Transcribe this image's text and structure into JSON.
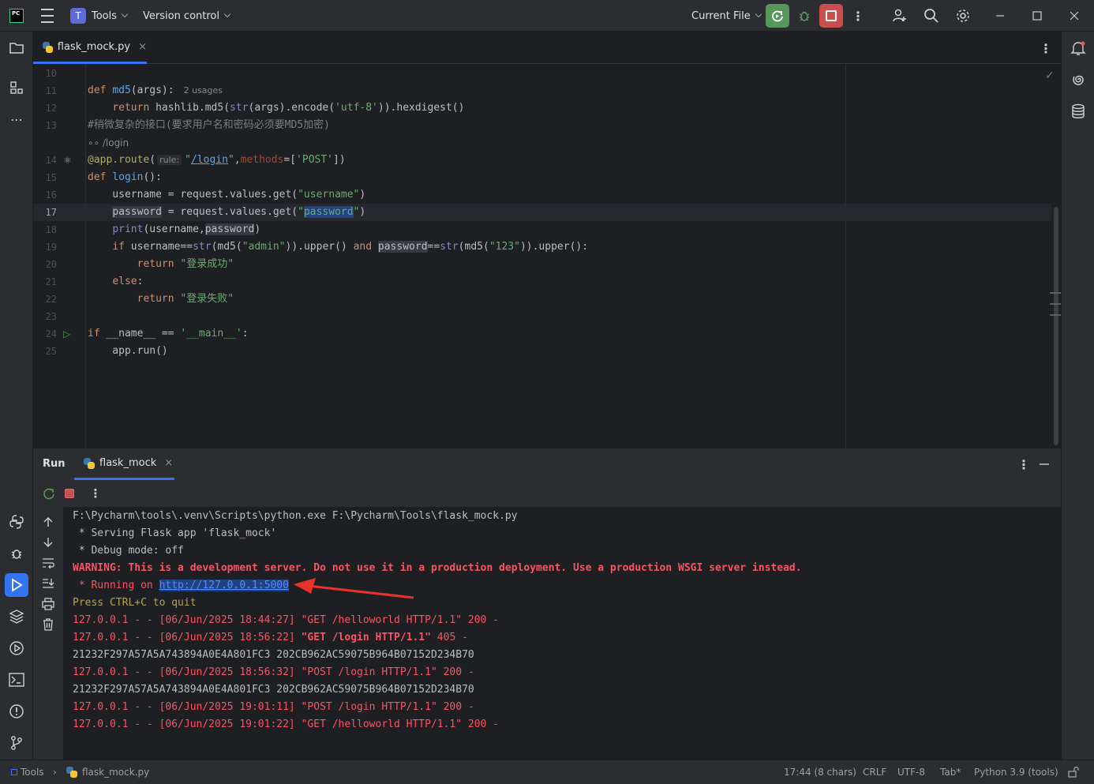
{
  "titlebar": {
    "app_logo": "PC",
    "project_initial": "T",
    "project_name": "Tools",
    "vcs_label": "Version control",
    "run_config": "Current File"
  },
  "editor": {
    "tab_label": "flask_mock.py",
    "lines": [
      {
        "n": "10"
      },
      {
        "n": "11",
        "usages": "2 usages"
      },
      {
        "n": "12"
      },
      {
        "n": "13",
        "comment": "#稍微复杂的接口(要求用户名和密码必须要MD5加密)"
      },
      {
        "route_hint": "/login"
      },
      {
        "n": "14",
        "rule_hint": "rule:"
      },
      {
        "n": "15"
      },
      {
        "n": "16"
      },
      {
        "n": "17"
      },
      {
        "n": "18"
      },
      {
        "n": "19"
      },
      {
        "n": "20",
        "string": "\"登录成功\""
      },
      {
        "n": "21"
      },
      {
        "n": "22",
        "string": "\"登录失败\""
      },
      {
        "n": "23"
      },
      {
        "n": "24"
      },
      {
        "n": "25"
      }
    ]
  },
  "run_panel": {
    "title": "Run",
    "tab_label": "flask_mock",
    "console": [
      "F:\\Pycharm\\tools\\.venv\\Scripts\\python.exe F:\\Pycharm\\Tools\\flask_mock.py",
      " * Serving Flask app 'flask_mock'",
      " * Debug mode: off",
      "WARNING: This is a development server. Do not use it in a production deployment. Use a production WSGI server instead.",
      " * Running on ",
      "http://127.0.0.1:5000",
      "Press CTRL+C to quit",
      "127.0.0.1 - - [06/Jun/2025 18:44:27] \"GET /helloworld HTTP/1.1\" 200 -",
      "127.0.0.1 - - [06/Jun/2025 18:56:22] ",
      "\"GET /login HTTP/1.1\"",
      " 405 -",
      "21232F297A57A5A743894A0E4A801FC3 202CB962AC59075B964B07152D234B70",
      "127.0.0.1 - - [06/Jun/2025 18:56:32] \"POST /login HTTP/1.1\" 200 -",
      "21232F297A57A5A743894A0E4A801FC3 202CB962AC59075B964B07152D234B70",
      "127.0.0.1 - - [06/Jun/2025 19:01:11] \"POST /login HTTP/1.1\" 200 -",
      "127.0.0.1 - - [06/Jun/2025 19:01:22] \"GET /helloworld HTTP/1.1\" 200 -"
    ]
  },
  "statusbar": {
    "project": "Tools",
    "file": "flask_mock.py",
    "position": "17:44 (8 chars)",
    "line_sep": "CRLF",
    "encoding": "UTF-8",
    "indent": "Tab*",
    "interpreter": "Python 3.9 (tools)"
  },
  "colors": {
    "accent": "#3574f0",
    "run_green": "#57965c",
    "stop_red": "#c94f4f",
    "console_error": "#f75464",
    "arrow_red": "#e8322b"
  }
}
